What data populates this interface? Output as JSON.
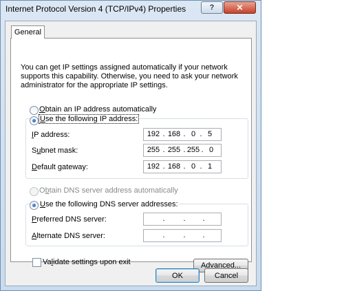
{
  "window": {
    "title": "Internet Protocol Version 4 (TCP/IPv4) Properties",
    "help_label": "?",
    "close_label": "✕"
  },
  "tabs": [
    {
      "label": "General"
    }
  ],
  "description": "You can get IP settings assigned automatically if your network supports this capability. Otherwise, you need to ask your network administrator for the appropriate IP settings.",
  "ip_mode": {
    "auto": {
      "label_pre": "",
      "label_u": "O",
      "label_post": "btain an IP address automatically",
      "selected": false
    },
    "manual": {
      "label_pre": "",
      "label_u": "U",
      "label_post": "se the following IP address:",
      "selected": true
    }
  },
  "ip_fields": {
    "ip_address": {
      "label_pre": "",
      "label_u": "I",
      "label_post": "P address:",
      "octets": [
        "192",
        "168",
        "0",
        "5"
      ]
    },
    "subnet_mask": {
      "label_pre": "S",
      "label_u": "u",
      "label_post": "bnet mask:",
      "octets": [
        "255",
        "255",
        "255",
        "0"
      ]
    },
    "default_gateway": {
      "label_pre": "",
      "label_u": "D",
      "label_post": "efault gateway:",
      "octets": [
        "192",
        "168",
        "0",
        "1"
      ]
    }
  },
  "dns_mode": {
    "auto": {
      "label_pre": "O",
      "label_u": "b",
      "label_post": "tain DNS server address automatically",
      "selected": false,
      "enabled": false
    },
    "manual": {
      "label_pre": "",
      "label_u": "U",
      "label_post": "se the following DNS server addresses:",
      "selected": true
    }
  },
  "dns_fields": {
    "preferred": {
      "label_pre": "",
      "label_u": "P",
      "label_post": "referred DNS server:",
      "octets": [
        "",
        "",
        "",
        ""
      ]
    },
    "alternate": {
      "label_pre": "",
      "label_u": "A",
      "label_post": "lternate DNS server:",
      "octets": [
        "",
        "",
        "",
        ""
      ]
    }
  },
  "validate": {
    "label_pre": "Va",
    "label_u": "l",
    "label_post": "idate settings upon exit",
    "checked": false
  },
  "buttons": {
    "advanced": {
      "label_pre": "Ad",
      "label_u": "v",
      "label_post": "anced..."
    },
    "ok": "OK",
    "cancel": "Cancel"
  }
}
